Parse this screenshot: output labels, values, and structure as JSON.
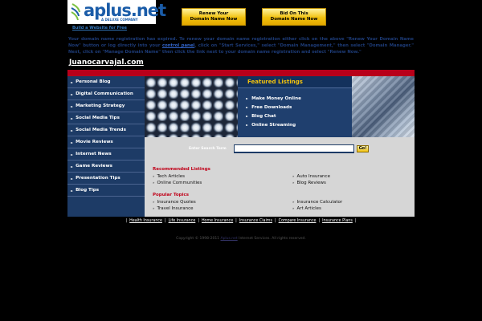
{
  "logo": {
    "brand": "aplus.net",
    "tagline": "A DELUXE COMPANY"
  },
  "build_link": "Build a Website for Free",
  "buttons": {
    "renew_line1": "Renew Your",
    "renew_line2": "Domain Name Now",
    "bid_line1": "Bid On This",
    "bid_line2": "Domain Name Now"
  },
  "notice": {
    "part1": "Your domain name registration has expired. To renew your domain name registration either click on the above \"Renew Your Domain Name Now\" button or log directly into your ",
    "link": "control panel",
    "part2": ", click on \"Start Services,\" select \"Domain Management,\" then select \"Domain Manager.\" Next, click on \"Manage Domain Name\" then click the link next to your domain name registration and select \"Renew Now.\""
  },
  "domain_title": "Juanocarvajal.com",
  "nav": [
    "Personal Blog",
    "Digital Communication",
    "Marketing Strategy",
    "Social Media Tips",
    "Social Media Trends",
    "Movie Reviews",
    "Internet News",
    "Game Reviews",
    "Presentation Tips",
    "Blog Tips"
  ],
  "featured": {
    "title": "Featured Listings",
    "items": [
      "Make Money Online",
      "Free Downloads",
      "Blog Chat",
      "Online Streaming"
    ]
  },
  "search": {
    "label": "Enter Search Term",
    "go": "Go!"
  },
  "recommended": {
    "title": "Recommended Listings",
    "left": [
      "Tech Articles",
      "Online Communities"
    ],
    "right": [
      "Auto Insurance",
      "Blog Reviews"
    ]
  },
  "popular": {
    "title": "Popular Topics",
    "left": [
      "Insurance Quotes",
      "Travel Insurance"
    ],
    "right": [
      "Insurance Calculator",
      "Art Articles"
    ]
  },
  "footer_links": [
    "Health Insurance",
    "Life Insurance",
    "Home Insurance",
    "Insurance Claims",
    "Compare Insurance",
    "Insurance Plans"
  ],
  "copyright": {
    "pre": "Copyright © 1998-2011 ",
    "link": "Aplus.net",
    "post": " Internet Services. All rights reserved."
  },
  "colors": {
    "nav_bg": "#1d3b66",
    "red_bar": "#b8001a",
    "gold": "#f2c20e",
    "brand_blue": "#1a5ca8"
  },
  "icons": {
    "nav_arrow": "arrow-right-icon",
    "bullet": "bullet-icon",
    "logo_swoosh": "swoosh-icon"
  }
}
